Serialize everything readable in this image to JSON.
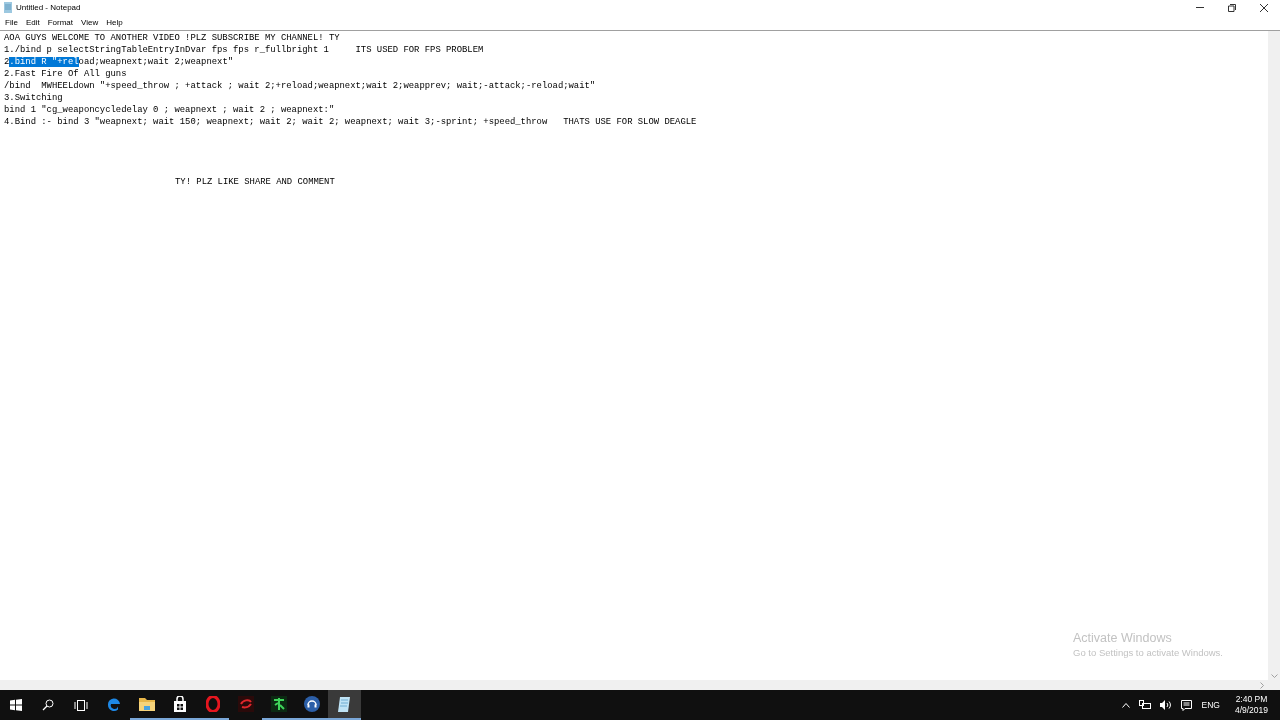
{
  "window": {
    "title": "Untitled - Notepad"
  },
  "menu": [
    {
      "label": "File"
    },
    {
      "label": "Edit"
    },
    {
      "label": "Format"
    },
    {
      "label": "View"
    },
    {
      "label": "Help"
    }
  ],
  "editor": {
    "lines": [
      [
        {
          "text": "AOA GUYS WELCOME TO ANOTHER VIDEO !PLZ SUBSCRIBE MY CHANNEL! TY",
          "selected": false
        }
      ],
      [
        {
          "text": "1./bind p selectStringTableEntryInDvar fps fps r_fullbright 1     ITS USED FOR FPS PROBLEM",
          "selected": false
        }
      ],
      [
        {
          "text": "2",
          "selected": false
        },
        {
          "text": ".bind R \"+rel",
          "selected": true
        },
        {
          "text": "oad;weapnext;wait 2;weapnext\"",
          "selected": false
        }
      ],
      [
        {
          "text": "2.Fast Fire Of All guns",
          "selected": false
        }
      ],
      [
        {
          "text": "/bind  MWHEELdown \"+speed_throw ; +attack ; wait 2;+reload;weapnext;wait 2;weapprev; wait;-attack;-reload;wait\"",
          "selected": false
        }
      ],
      [
        {
          "text": "3.Switching",
          "selected": false
        }
      ],
      [
        {
          "text": "bind 1 \"cg_weaponcycledelay 0 ; weapnext ; wait 2 ; weapnext:\"",
          "selected": false
        }
      ],
      [
        {
          "text": "4.Bind :- bind 3 \"weapnext; wait 150; weapnext; wait 2; wait 2; weapnext; wait 3;-sprint; +speed_throw   THATS USE FOR SLOW DEAGLE",
          "selected": false
        }
      ]
    ],
    "footer_line": "TY! PLZ LIKE SHARE AND COMMENT"
  },
  "activation": {
    "title": "Activate Windows",
    "subtitle": "Go to Settings to activate Windows."
  },
  "taskbar": {
    "apps": [
      {
        "kind": "edge",
        "active": false,
        "selected": false
      },
      {
        "kind": "folder",
        "active": true,
        "selected": false
      },
      {
        "kind": "store",
        "active": true,
        "selected": false
      },
      {
        "kind": "opera",
        "active": true,
        "selected": false
      },
      {
        "kind": "garena",
        "active": false,
        "selected": false
      },
      {
        "kind": "game",
        "active": true,
        "selected": false
      },
      {
        "kind": "headset",
        "active": true,
        "selected": false
      },
      {
        "kind": "notepad",
        "active": true,
        "selected": true
      }
    ],
    "language": "ENG",
    "time": "2:40 PM",
    "date": "4/9/2019"
  }
}
